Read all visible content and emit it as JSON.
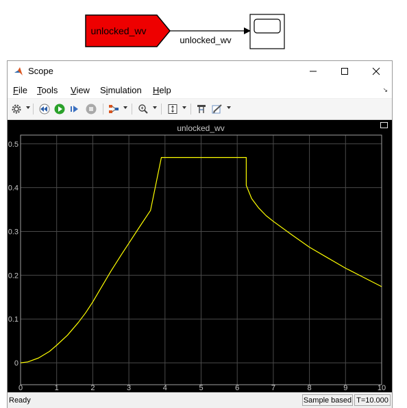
{
  "diagram": {
    "goto_block_label": "unlocked_wv",
    "signal_label": "unlocked_wv",
    "goto_color": "#ee0000"
  },
  "window": {
    "title": "Scope",
    "controls": [
      "minimize-icon",
      "maximize-icon",
      "close-icon"
    ]
  },
  "menu": {
    "items": [
      {
        "mnemonic": "F",
        "rest": "ile"
      },
      {
        "mnemonic": "T",
        "rest": "ools"
      },
      {
        "mnemonic": "V",
        "rest": "iew"
      },
      {
        "pre": "S",
        "mnemonic": "i",
        "rest": "mulation"
      },
      {
        "mnemonic": "H",
        "rest": "elp"
      }
    ]
  },
  "toolbar": {
    "icons": [
      "gear-icon",
      "step-back-icon",
      "run-icon",
      "step-forward-icon",
      "stop-icon",
      "signal-selector-icon",
      "zoom-in-icon",
      "autoscale-icon",
      "cursor-measurement-icon",
      "style-edit-icon"
    ]
  },
  "plot": {
    "title": "unlocked_wv",
    "background": "#000000",
    "line_color": "#ffff00"
  },
  "status": {
    "ready": "Ready",
    "sample_mode": "Sample based",
    "time": "T=10.000"
  },
  "chart_data": {
    "type": "line",
    "title": "unlocked_wv",
    "xlabel": "",
    "ylabel": "",
    "xlim": [
      0,
      10
    ],
    "ylim": [
      -0.05,
      0.52
    ],
    "x_ticks": [
      "0",
      "1",
      "2",
      "3",
      "4",
      "5",
      "6",
      "7",
      "8",
      "9",
      "10"
    ],
    "y_ticks": [
      "0",
      "0.1",
      "0.2",
      "0.3",
      "0.4",
      "0.5"
    ],
    "grid": true,
    "series": [
      {
        "x": [
          0,
          0.2,
          0.5,
          0.8,
          1.0,
          1.3,
          1.6,
          1.8,
          2.0,
          2.2,
          2.5,
          2.8,
          3.0,
          3.3,
          3.6,
          3.9,
          4.5,
          5.0,
          5.5,
          6.0,
          6.25,
          6.25,
          6.4,
          6.6,
          6.8,
          7.0,
          7.5,
          8.0,
          8.5,
          9.0,
          9.5,
          10.0
        ],
        "y": [
          0,
          0.002,
          0.011,
          0.026,
          0.04,
          0.063,
          0.092,
          0.114,
          0.139,
          0.167,
          0.209,
          0.248,
          0.273,
          0.311,
          0.348,
          0.469,
          0.469,
          0.469,
          0.469,
          0.469,
          0.469,
          0.405,
          0.375,
          0.353,
          0.336,
          0.323,
          0.293,
          0.264,
          0.24,
          0.216,
          0.195,
          0.174
        ]
      }
    ]
  }
}
